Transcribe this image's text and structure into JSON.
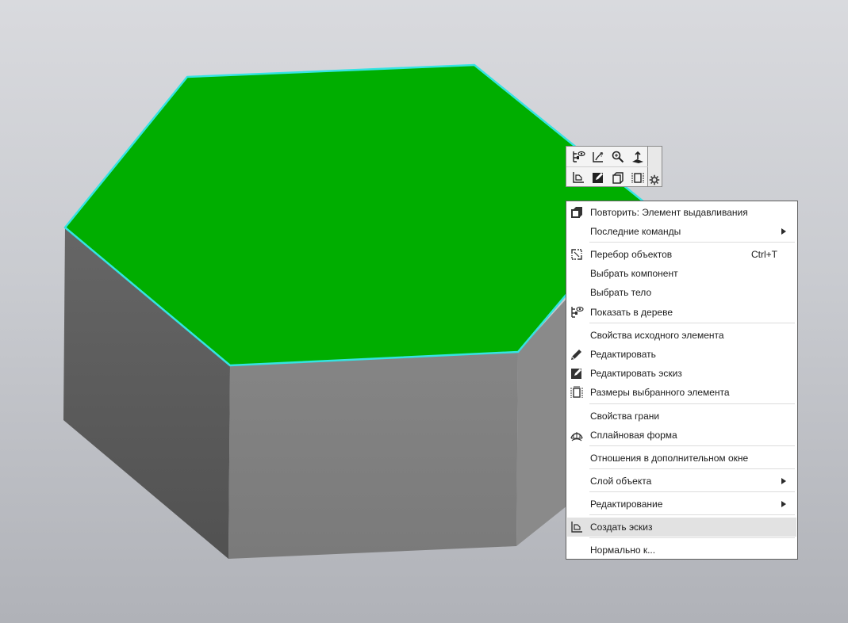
{
  "scene": {
    "object": "hexagonal-prism",
    "colors": {
      "top_face": "#00ae00",
      "edge_highlight": "#35e3e3",
      "left_face": "#5b5b5b",
      "front_face": "#808080",
      "right_face": "#888888"
    }
  },
  "toolbar": {
    "buttons": [
      {
        "icon": "show-in-tree-icon"
      },
      {
        "icon": "select-body-icon"
      },
      {
        "icon": "zoom-icon"
      },
      {
        "icon": "normal-to-icon"
      },
      {
        "icon": "sketch-icon"
      },
      {
        "icon": "edit-sketch-icon"
      },
      {
        "icon": "repeat-icon"
      },
      {
        "icon": "dimensions-icon"
      }
    ],
    "settings_icon": "gear-icon"
  },
  "menu": {
    "items": [
      {
        "label": "Повторить: Элемент выдавливания",
        "icon": "repeat-extrude-icon"
      },
      {
        "label": "Последние команды",
        "submenu": true
      },
      {
        "label": "Перебор объектов",
        "shortcut": "Ctrl+T",
        "icon": "cycle-objects-icon"
      },
      {
        "label": "Выбрать компонент"
      },
      {
        "label": "Выбрать тело"
      },
      {
        "label": "Показать в дереве",
        "icon": "show-in-tree-icon"
      },
      {
        "label": "Свойства исходного элемента"
      },
      {
        "label": "Редактировать",
        "icon": "pencil-icon"
      },
      {
        "label": "Редактировать эскиз",
        "icon": "edit-sketch-icon"
      },
      {
        "label": "Размеры выбранного элемента",
        "icon": "dimensions-icon"
      },
      {
        "label": "Свойства грани"
      },
      {
        "label": "Сплайновая форма",
        "icon": "spline-form-icon"
      },
      {
        "label": "Отношения в дополнительном окне"
      },
      {
        "label": "Слой объекта",
        "submenu": true
      },
      {
        "label": "Редактирование",
        "submenu": true
      },
      {
        "label": "Создать эскиз",
        "icon": "sketch-icon",
        "highlighted": true
      },
      {
        "label": "Нормально к..."
      }
    ]
  }
}
